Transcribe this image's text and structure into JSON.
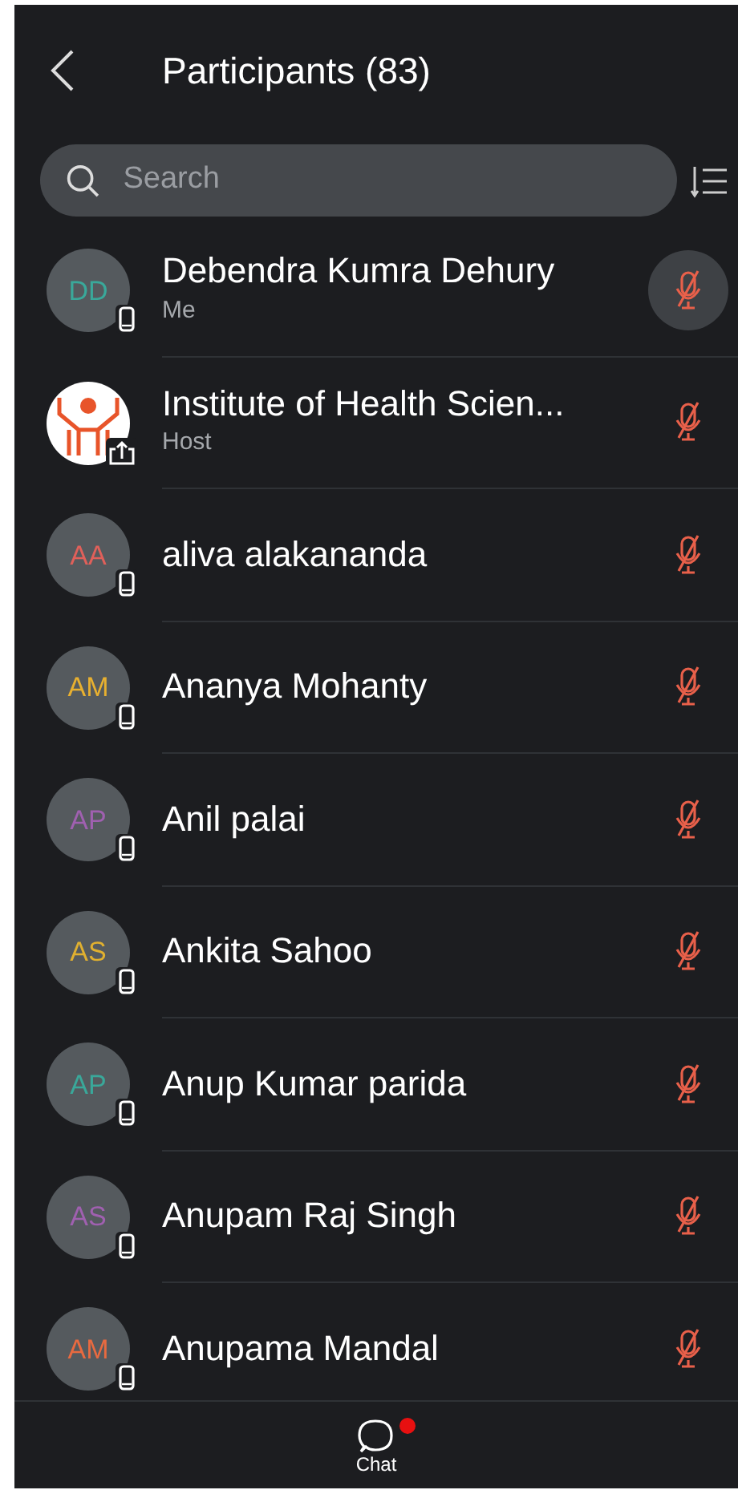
{
  "header": {
    "title": "Participants (83)"
  },
  "search": {
    "placeholder": "Search"
  },
  "participants": [
    {
      "kind": "initials",
      "initials": "DD",
      "color": "#3aa89a",
      "badge": {
        "kind": "phone"
      },
      "name": "Debendra Kumra Dehury",
      "role": "Me",
      "muted": true,
      "mic_highlighted": true
    },
    {
      "kind": "logo",
      "badge": {
        "kind": "share"
      },
      "name": "Institute of Health Scien...",
      "role": "Host",
      "muted": true,
      "mic_highlighted": false
    },
    {
      "kind": "initials",
      "initials": "AA",
      "color": "#e0605a",
      "badge": {
        "kind": "phone"
      },
      "name": "aliva alakananda",
      "muted": true,
      "mic_highlighted": false
    },
    {
      "kind": "initials",
      "initials": "AM",
      "color": "#e8b030",
      "badge": {
        "kind": "phone"
      },
      "name": "Ananya Mohanty",
      "muted": true,
      "mic_highlighted": false
    },
    {
      "kind": "initials",
      "initials": "AP",
      "color": "#a060b0",
      "badge": {
        "kind": "phone"
      },
      "name": "Anil palai",
      "muted": true,
      "mic_highlighted": false
    },
    {
      "kind": "initials",
      "initials": "AS",
      "color": "#e0b030",
      "badge": {
        "kind": "phone"
      },
      "name": "Ankita Sahoo",
      "muted": true,
      "mic_highlighted": false
    },
    {
      "kind": "initials",
      "initials": "AP",
      "color": "#3aa89a",
      "badge": {
        "kind": "phone"
      },
      "name": "Anup Kumar parida",
      "muted": true,
      "mic_highlighted": false
    },
    {
      "kind": "initials",
      "initials": "AS",
      "color": "#a060b0",
      "badge": {
        "kind": "phone"
      },
      "name": "Anupam Raj Singh",
      "muted": true,
      "mic_highlighted": false
    },
    {
      "kind": "initials",
      "initials": "AM",
      "color": "#e86a40",
      "badge": {
        "kind": "phone"
      },
      "name": "Anupama Mandal",
      "muted": true,
      "mic_highlighted": false
    }
  ],
  "bottom_bar": {
    "label": "Chat",
    "unread": true
  }
}
